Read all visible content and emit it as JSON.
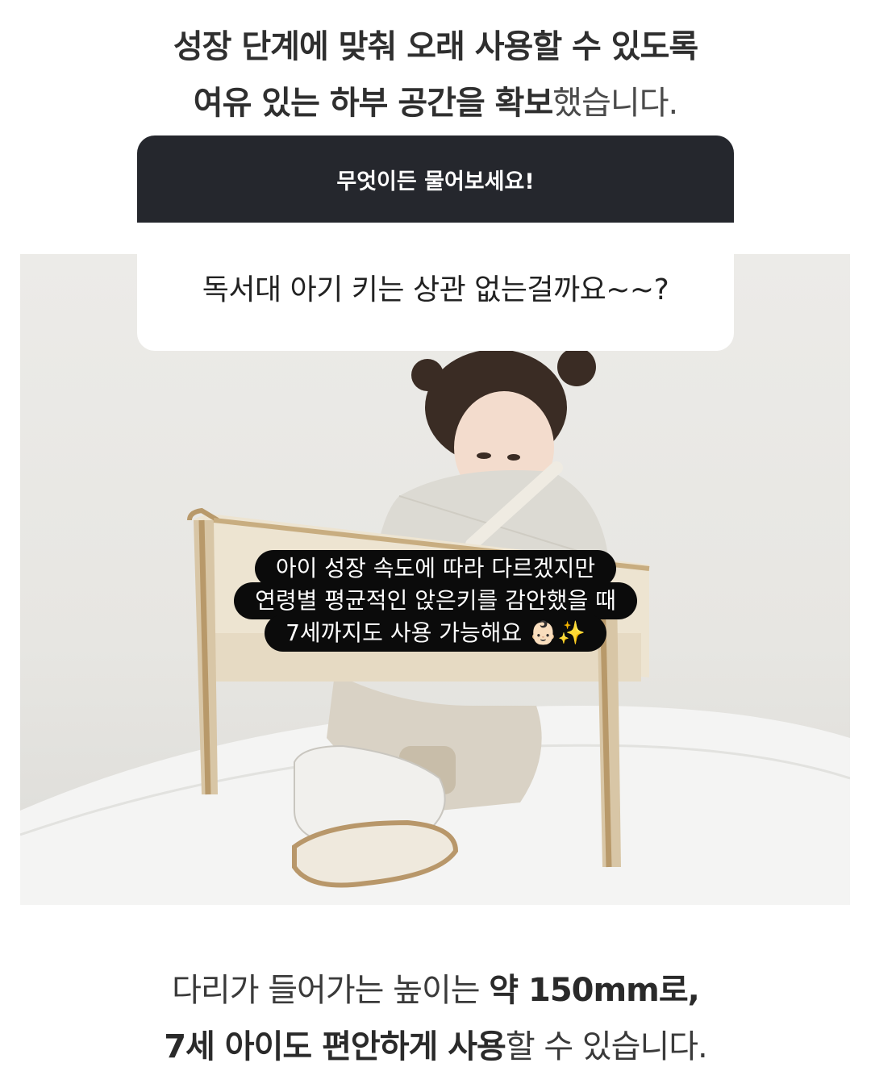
{
  "intro": {
    "line1": "성장 단계에 맞춰 오래 사용할 수 있도록",
    "line2_bold": "여유 있는 하부 공간을 확보",
    "line2_light": "했습니다."
  },
  "question_box": {
    "header": "무엇이든 물어보세요!",
    "question": "독서대 아기 키는 상관 없는걸까요~~?"
  },
  "answer": {
    "line1": "아이 성장 속도에 따라 다르겠지만",
    "line2": "연령별 평균적인 앉은키를 감안했을 때",
    "line3": "7세까지도 사용 가능해요 👶🏻✨"
  },
  "outro": {
    "line1_light": "다리가 들어가는 높이는 ",
    "line1_bold": "약 150mm로,",
    "line2_bold": "7세 아이도 편안하게 사용",
    "line2_light": "할 수 있습니다."
  },
  "colors": {
    "dark_header": "#25272d",
    "answer_pill": "#0b0b0b",
    "wall": "#ecebe8",
    "wood": "#e3d6bf"
  }
}
